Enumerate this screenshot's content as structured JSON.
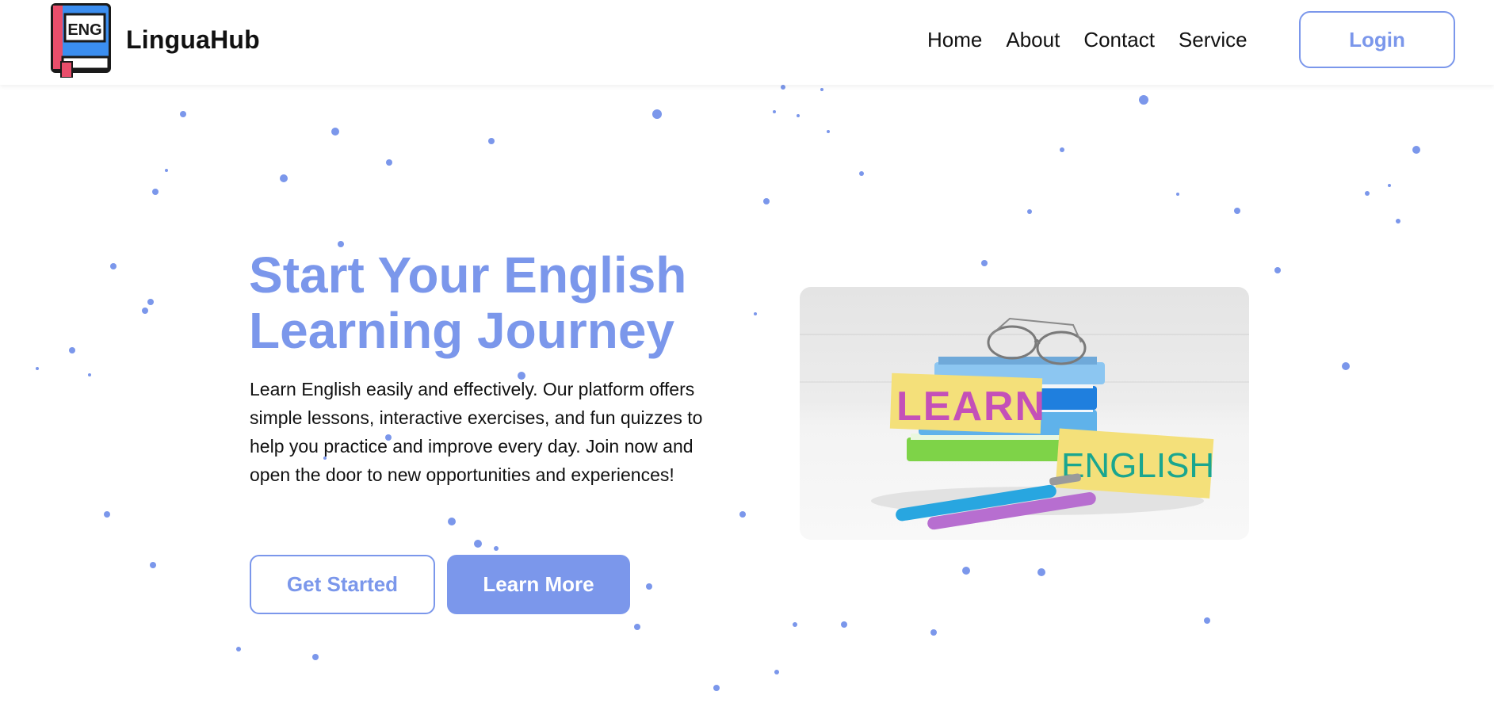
{
  "header": {
    "logo_text": "ENG",
    "brand": "LinguaHub",
    "nav": [
      "Home",
      "About",
      "Contact",
      "Service"
    ],
    "login_label": "Login"
  },
  "hero": {
    "title_line1": "Start Your English",
    "title_line2": "Learning Journey",
    "description_lines": [
      "Learn English easily and effectively. Our platform offers",
      "simple lessons, interactive exercises, and fun quizzes to",
      "help you practice and improve every day. Join now and",
      "open the door to new opportunities and experiences!"
    ],
    "primary_button": "Get Started",
    "secondary_button": "Learn More",
    "image": {
      "icon": "books-learn-english-image",
      "sign_learn": "LEARN",
      "sign_english": "ENGLISH"
    }
  },
  "colors": {
    "accent": "#7b97eb",
    "text": "#111111",
    "background": "#ffffff",
    "logo_blue": "#3b8ef0",
    "logo_red": "#e94e6b"
  }
}
